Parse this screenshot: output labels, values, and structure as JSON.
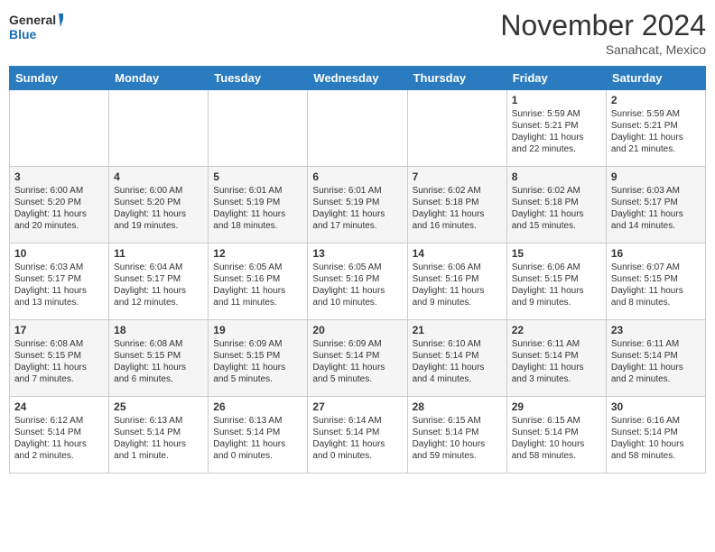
{
  "header": {
    "logo_general": "General",
    "logo_blue": "Blue",
    "month_title": "November 2024",
    "location": "Sanahcat, Mexico"
  },
  "days_of_week": [
    "Sunday",
    "Monday",
    "Tuesday",
    "Wednesday",
    "Thursday",
    "Friday",
    "Saturday"
  ],
  "weeks": [
    [
      {
        "day": "",
        "info": ""
      },
      {
        "day": "",
        "info": ""
      },
      {
        "day": "",
        "info": ""
      },
      {
        "day": "",
        "info": ""
      },
      {
        "day": "",
        "info": ""
      },
      {
        "day": "1",
        "info": "Sunrise: 5:59 AM\nSunset: 5:21 PM\nDaylight: 11 hours and 22 minutes."
      },
      {
        "day": "2",
        "info": "Sunrise: 5:59 AM\nSunset: 5:21 PM\nDaylight: 11 hours and 21 minutes."
      }
    ],
    [
      {
        "day": "3",
        "info": "Sunrise: 6:00 AM\nSunset: 5:20 PM\nDaylight: 11 hours and 20 minutes."
      },
      {
        "day": "4",
        "info": "Sunrise: 6:00 AM\nSunset: 5:20 PM\nDaylight: 11 hours and 19 minutes."
      },
      {
        "day": "5",
        "info": "Sunrise: 6:01 AM\nSunset: 5:19 PM\nDaylight: 11 hours and 18 minutes."
      },
      {
        "day": "6",
        "info": "Sunrise: 6:01 AM\nSunset: 5:19 PM\nDaylight: 11 hours and 17 minutes."
      },
      {
        "day": "7",
        "info": "Sunrise: 6:02 AM\nSunset: 5:18 PM\nDaylight: 11 hours and 16 minutes."
      },
      {
        "day": "8",
        "info": "Sunrise: 6:02 AM\nSunset: 5:18 PM\nDaylight: 11 hours and 15 minutes."
      },
      {
        "day": "9",
        "info": "Sunrise: 6:03 AM\nSunset: 5:17 PM\nDaylight: 11 hours and 14 minutes."
      }
    ],
    [
      {
        "day": "10",
        "info": "Sunrise: 6:03 AM\nSunset: 5:17 PM\nDaylight: 11 hours and 13 minutes."
      },
      {
        "day": "11",
        "info": "Sunrise: 6:04 AM\nSunset: 5:17 PM\nDaylight: 11 hours and 12 minutes."
      },
      {
        "day": "12",
        "info": "Sunrise: 6:05 AM\nSunset: 5:16 PM\nDaylight: 11 hours and 11 minutes."
      },
      {
        "day": "13",
        "info": "Sunrise: 6:05 AM\nSunset: 5:16 PM\nDaylight: 11 hours and 10 minutes."
      },
      {
        "day": "14",
        "info": "Sunrise: 6:06 AM\nSunset: 5:16 PM\nDaylight: 11 hours and 9 minutes."
      },
      {
        "day": "15",
        "info": "Sunrise: 6:06 AM\nSunset: 5:15 PM\nDaylight: 11 hours and 9 minutes."
      },
      {
        "day": "16",
        "info": "Sunrise: 6:07 AM\nSunset: 5:15 PM\nDaylight: 11 hours and 8 minutes."
      }
    ],
    [
      {
        "day": "17",
        "info": "Sunrise: 6:08 AM\nSunset: 5:15 PM\nDaylight: 11 hours and 7 minutes."
      },
      {
        "day": "18",
        "info": "Sunrise: 6:08 AM\nSunset: 5:15 PM\nDaylight: 11 hours and 6 minutes."
      },
      {
        "day": "19",
        "info": "Sunrise: 6:09 AM\nSunset: 5:15 PM\nDaylight: 11 hours and 5 minutes."
      },
      {
        "day": "20",
        "info": "Sunrise: 6:09 AM\nSunset: 5:14 PM\nDaylight: 11 hours and 5 minutes."
      },
      {
        "day": "21",
        "info": "Sunrise: 6:10 AM\nSunset: 5:14 PM\nDaylight: 11 hours and 4 minutes."
      },
      {
        "day": "22",
        "info": "Sunrise: 6:11 AM\nSunset: 5:14 PM\nDaylight: 11 hours and 3 minutes."
      },
      {
        "day": "23",
        "info": "Sunrise: 6:11 AM\nSunset: 5:14 PM\nDaylight: 11 hours and 2 minutes."
      }
    ],
    [
      {
        "day": "24",
        "info": "Sunrise: 6:12 AM\nSunset: 5:14 PM\nDaylight: 11 hours and 2 minutes."
      },
      {
        "day": "25",
        "info": "Sunrise: 6:13 AM\nSunset: 5:14 PM\nDaylight: 11 hours and 1 minute."
      },
      {
        "day": "26",
        "info": "Sunrise: 6:13 AM\nSunset: 5:14 PM\nDaylight: 11 hours and 0 minutes."
      },
      {
        "day": "27",
        "info": "Sunrise: 6:14 AM\nSunset: 5:14 PM\nDaylight: 11 hours and 0 minutes."
      },
      {
        "day": "28",
        "info": "Sunrise: 6:15 AM\nSunset: 5:14 PM\nDaylight: 10 hours and 59 minutes."
      },
      {
        "day": "29",
        "info": "Sunrise: 6:15 AM\nSunset: 5:14 PM\nDaylight: 10 hours and 58 minutes."
      },
      {
        "day": "30",
        "info": "Sunrise: 6:16 AM\nSunset: 5:14 PM\nDaylight: 10 hours and 58 minutes."
      }
    ]
  ]
}
